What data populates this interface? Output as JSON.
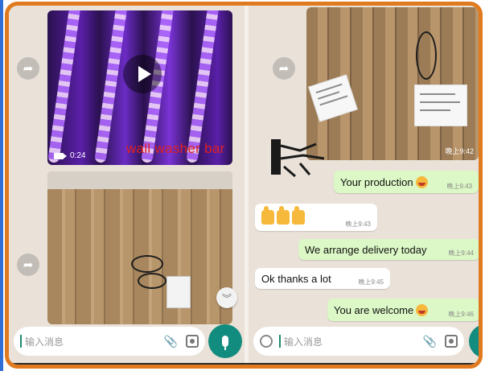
{
  "left_panel": {
    "video": {
      "duration": "0:24",
      "overlay_label": "wall washer bar"
    },
    "composer": {
      "placeholder": "输入消息"
    }
  },
  "right_panel": {
    "image": {
      "time": "晚上9:42"
    },
    "messages": [
      {
        "direction": "out",
        "text": "Your production",
        "emoji": "grin",
        "time": "晚上9:43"
      },
      {
        "direction": "in",
        "text": "",
        "emoji": "thumbs-up x3",
        "time": "晚上9:43"
      },
      {
        "direction": "out",
        "text": "We arrange delivery today",
        "emoji": "",
        "time": "晚上9:44"
      },
      {
        "direction": "in",
        "text": "Ok thanks a lot",
        "emoji": "",
        "time": "晚上9:45"
      },
      {
        "direction": "out",
        "text": "You are welcome",
        "emoji": "grin",
        "time": "晚上9:46"
      }
    ],
    "composer": {
      "placeholder": "输入消息"
    }
  },
  "icons": {
    "forward": "forward-icon",
    "play": "play-icon",
    "video_camera": "video-camera-icon",
    "attach": "paperclip-icon",
    "camera": "camera-icon",
    "mic": "microphone-icon",
    "emoji": "emoji-icon",
    "scroll_down": "chevron-double-down-icon"
  },
  "colors": {
    "outgoing_bubble": "#dcf8c6",
    "incoming_bubble": "#ffffff",
    "chat_background": "#eae2d8",
    "mic_button": "#128c7e",
    "border": "#e07a1f",
    "overlay_text": "#e02020"
  }
}
